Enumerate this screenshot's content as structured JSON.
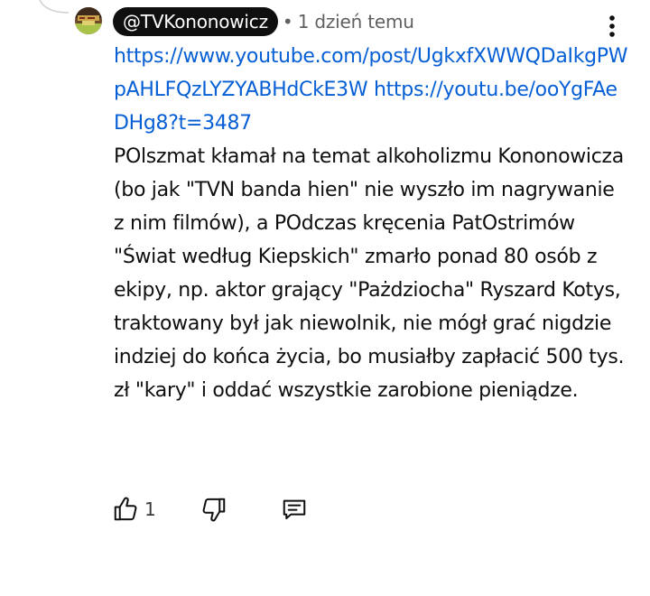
{
  "comment": {
    "author_handle": "@TVKononowicz",
    "separator": "•",
    "timestamp": "1 dzień temu",
    "link_1": "https://www.youtube.com/post/UgkxfXWWQDaIkgPWpAHLFQzLYZYABHdCkE3W",
    "link_2": "https://youtu.be/ooYgFAeDHg8?t=3487",
    "text": "POlszmat kłamał na temat alkoholizmu Kononowicza (bo jak \"TVN banda hien\" nie wyszło im nagrywanie z nim filmów), a POdczas kręcenia PatOstrimów \"Świat według Kiepskich\" zmarło ponad 80 osób z ekipy, np. aktor grający \"Pażdziocha\" Ryszard Kotys, traktowany był jak niewolnik, nie mógł grać nigdzie indziej do końca życia, bo musiałby zapłacić 500 tys. zł \"kary\" i oddać wszystkie zarobione pieniądze."
  },
  "actions": {
    "like_count": "1"
  },
  "icons": {
    "avatar": "avatar-image",
    "more": "more-vertical-icon",
    "like": "thumbs-up-icon",
    "dislike": "thumbs-down-icon",
    "reply": "reply-comment-icon"
  },
  "colors": {
    "link": "#065fd4",
    "chip_background": "#0f0f0f",
    "secondary_text": "#606060"
  }
}
